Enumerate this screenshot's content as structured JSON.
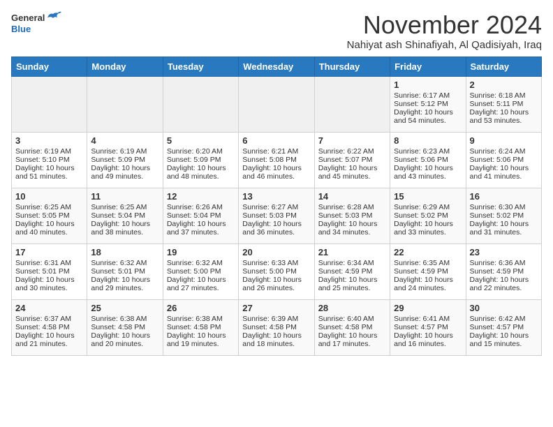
{
  "header": {
    "logo_line1": "General",
    "logo_line2": "Blue",
    "month_title": "November 2024",
    "location": "Nahiyat ash Shinafiyah, Al Qadisiyah, Iraq"
  },
  "weekdays": [
    "Sunday",
    "Monday",
    "Tuesday",
    "Wednesday",
    "Thursday",
    "Friday",
    "Saturday"
  ],
  "weeks": [
    [
      {
        "day": "",
        "lines": []
      },
      {
        "day": "",
        "lines": []
      },
      {
        "day": "",
        "lines": []
      },
      {
        "day": "",
        "lines": []
      },
      {
        "day": "",
        "lines": []
      },
      {
        "day": "1",
        "lines": [
          "Sunrise: 6:17 AM",
          "Sunset: 5:12 PM",
          "Daylight: 10 hours",
          "and 54 minutes."
        ]
      },
      {
        "day": "2",
        "lines": [
          "Sunrise: 6:18 AM",
          "Sunset: 5:11 PM",
          "Daylight: 10 hours",
          "and 53 minutes."
        ]
      }
    ],
    [
      {
        "day": "3",
        "lines": [
          "Sunrise: 6:19 AM",
          "Sunset: 5:10 PM",
          "Daylight: 10 hours",
          "and 51 minutes."
        ]
      },
      {
        "day": "4",
        "lines": [
          "Sunrise: 6:19 AM",
          "Sunset: 5:09 PM",
          "Daylight: 10 hours",
          "and 49 minutes."
        ]
      },
      {
        "day": "5",
        "lines": [
          "Sunrise: 6:20 AM",
          "Sunset: 5:09 PM",
          "Daylight: 10 hours",
          "and 48 minutes."
        ]
      },
      {
        "day": "6",
        "lines": [
          "Sunrise: 6:21 AM",
          "Sunset: 5:08 PM",
          "Daylight: 10 hours",
          "and 46 minutes."
        ]
      },
      {
        "day": "7",
        "lines": [
          "Sunrise: 6:22 AM",
          "Sunset: 5:07 PM",
          "Daylight: 10 hours",
          "and 45 minutes."
        ]
      },
      {
        "day": "8",
        "lines": [
          "Sunrise: 6:23 AM",
          "Sunset: 5:06 PM",
          "Daylight: 10 hours",
          "and 43 minutes."
        ]
      },
      {
        "day": "9",
        "lines": [
          "Sunrise: 6:24 AM",
          "Sunset: 5:06 PM",
          "Daylight: 10 hours",
          "and 41 minutes."
        ]
      }
    ],
    [
      {
        "day": "10",
        "lines": [
          "Sunrise: 6:25 AM",
          "Sunset: 5:05 PM",
          "Daylight: 10 hours",
          "and 40 minutes."
        ]
      },
      {
        "day": "11",
        "lines": [
          "Sunrise: 6:25 AM",
          "Sunset: 5:04 PM",
          "Daylight: 10 hours",
          "and 38 minutes."
        ]
      },
      {
        "day": "12",
        "lines": [
          "Sunrise: 6:26 AM",
          "Sunset: 5:04 PM",
          "Daylight: 10 hours",
          "and 37 minutes."
        ]
      },
      {
        "day": "13",
        "lines": [
          "Sunrise: 6:27 AM",
          "Sunset: 5:03 PM",
          "Daylight: 10 hours",
          "and 36 minutes."
        ]
      },
      {
        "day": "14",
        "lines": [
          "Sunrise: 6:28 AM",
          "Sunset: 5:03 PM",
          "Daylight: 10 hours",
          "and 34 minutes."
        ]
      },
      {
        "day": "15",
        "lines": [
          "Sunrise: 6:29 AM",
          "Sunset: 5:02 PM",
          "Daylight: 10 hours",
          "and 33 minutes."
        ]
      },
      {
        "day": "16",
        "lines": [
          "Sunrise: 6:30 AM",
          "Sunset: 5:02 PM",
          "Daylight: 10 hours",
          "and 31 minutes."
        ]
      }
    ],
    [
      {
        "day": "17",
        "lines": [
          "Sunrise: 6:31 AM",
          "Sunset: 5:01 PM",
          "Daylight: 10 hours",
          "and 30 minutes."
        ]
      },
      {
        "day": "18",
        "lines": [
          "Sunrise: 6:32 AM",
          "Sunset: 5:01 PM",
          "Daylight: 10 hours",
          "and 29 minutes."
        ]
      },
      {
        "day": "19",
        "lines": [
          "Sunrise: 6:32 AM",
          "Sunset: 5:00 PM",
          "Daylight: 10 hours",
          "and 27 minutes."
        ]
      },
      {
        "day": "20",
        "lines": [
          "Sunrise: 6:33 AM",
          "Sunset: 5:00 PM",
          "Daylight: 10 hours",
          "and 26 minutes."
        ]
      },
      {
        "day": "21",
        "lines": [
          "Sunrise: 6:34 AM",
          "Sunset: 4:59 PM",
          "Daylight: 10 hours",
          "and 25 minutes."
        ]
      },
      {
        "day": "22",
        "lines": [
          "Sunrise: 6:35 AM",
          "Sunset: 4:59 PM",
          "Daylight: 10 hours",
          "and 24 minutes."
        ]
      },
      {
        "day": "23",
        "lines": [
          "Sunrise: 6:36 AM",
          "Sunset: 4:59 PM",
          "Daylight: 10 hours",
          "and 22 minutes."
        ]
      }
    ],
    [
      {
        "day": "24",
        "lines": [
          "Sunrise: 6:37 AM",
          "Sunset: 4:58 PM",
          "Daylight: 10 hours",
          "and 21 minutes."
        ]
      },
      {
        "day": "25",
        "lines": [
          "Sunrise: 6:38 AM",
          "Sunset: 4:58 PM",
          "Daylight: 10 hours",
          "and 20 minutes."
        ]
      },
      {
        "day": "26",
        "lines": [
          "Sunrise: 6:38 AM",
          "Sunset: 4:58 PM",
          "Daylight: 10 hours",
          "and 19 minutes."
        ]
      },
      {
        "day": "27",
        "lines": [
          "Sunrise: 6:39 AM",
          "Sunset: 4:58 PM",
          "Daylight: 10 hours",
          "and 18 minutes."
        ]
      },
      {
        "day": "28",
        "lines": [
          "Sunrise: 6:40 AM",
          "Sunset: 4:58 PM",
          "Daylight: 10 hours",
          "and 17 minutes."
        ]
      },
      {
        "day": "29",
        "lines": [
          "Sunrise: 6:41 AM",
          "Sunset: 4:57 PM",
          "Daylight: 10 hours",
          "and 16 minutes."
        ]
      },
      {
        "day": "30",
        "lines": [
          "Sunrise: 6:42 AM",
          "Sunset: 4:57 PM",
          "Daylight: 10 hours",
          "and 15 minutes."
        ]
      }
    ]
  ]
}
